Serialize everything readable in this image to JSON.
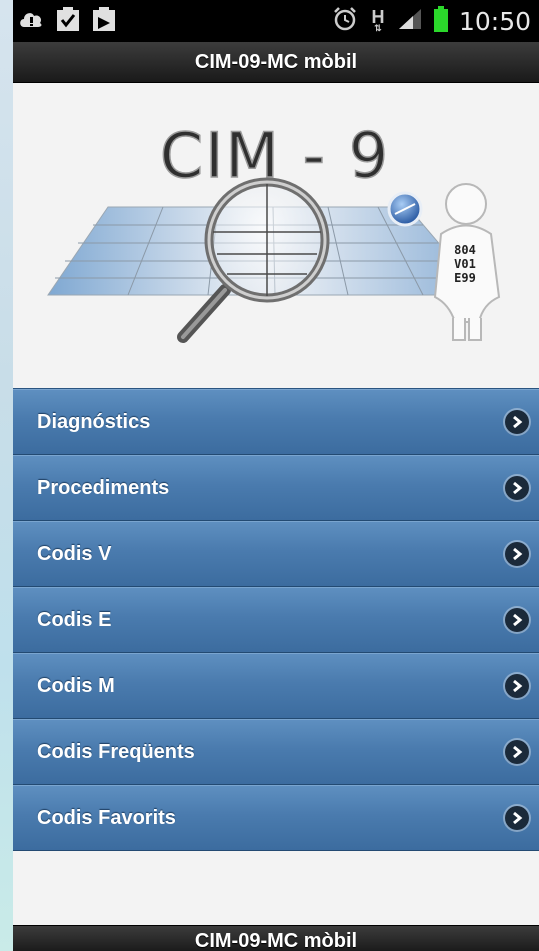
{
  "status_bar": {
    "time": "10:50",
    "left_icons": [
      "warning-cloud-icon",
      "clipboard-check-icon",
      "download-icon"
    ],
    "right_icons": [
      "alarm-icon",
      "h-plus-data-icon",
      "signal-icon",
      "battery-icon"
    ],
    "network_label": "H"
  },
  "app": {
    "title": "CIM-09-MC mòbil",
    "footer_title": "CIM-09-MC mòbil"
  },
  "logo": {
    "title": "CIM - 9",
    "tag_codes": [
      "804",
      "V01",
      "E99"
    ]
  },
  "menu": {
    "items": [
      {
        "label": "Diagnóstics"
      },
      {
        "label": "Procediments"
      },
      {
        "label": "Codis V"
      },
      {
        "label": "Codis E"
      },
      {
        "label": "Codis M"
      },
      {
        "label": "Codis Freqüents"
      },
      {
        "label": "Codis Favorits"
      }
    ]
  },
  "colors": {
    "menu_blue": "#4a7bae",
    "bar_black": "#1a1a1a",
    "battery_green": "#2bd82b"
  }
}
